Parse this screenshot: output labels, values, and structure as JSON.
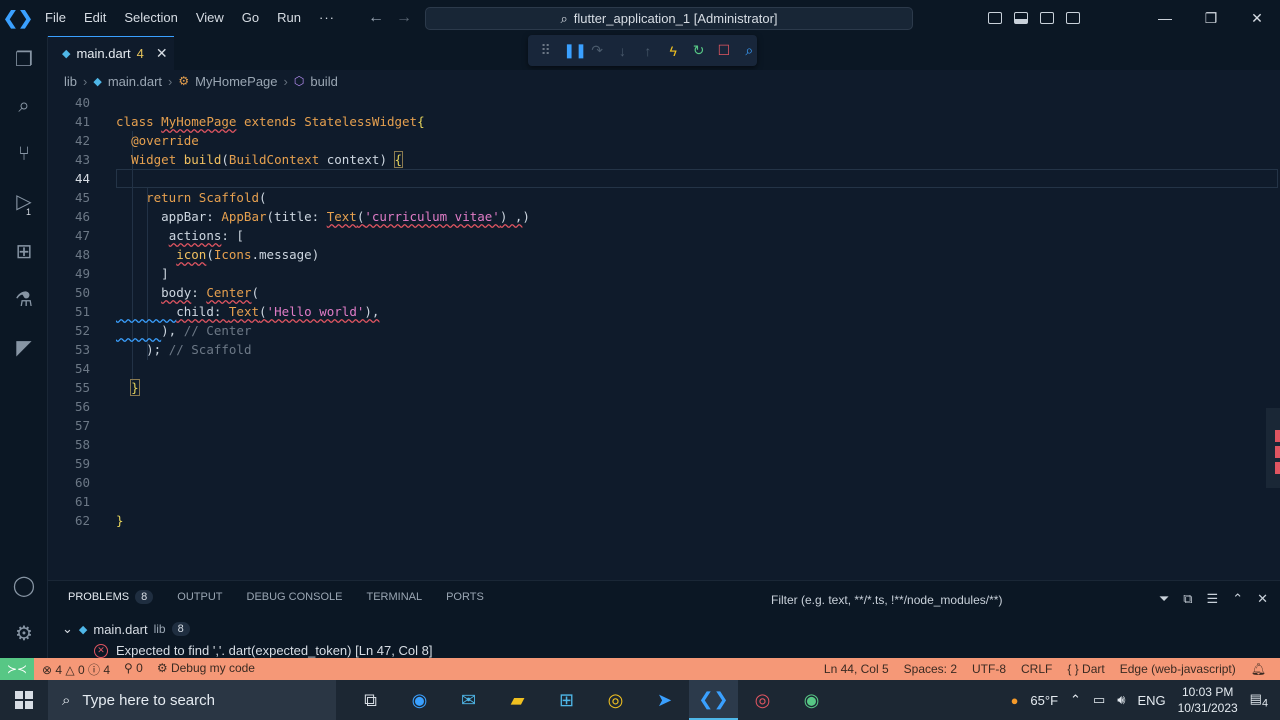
{
  "menu": [
    "File",
    "Edit",
    "Selection",
    "View",
    "Go",
    "Run",
    "···"
  ],
  "window_title": "flutter_application_1 [Administrator]",
  "tab": {
    "name": "main.dart",
    "problems": "4"
  },
  "breadcrumb": [
    "lib",
    "main.dart",
    "MyHomePage",
    "build"
  ],
  "editor": {
    "lines": [
      {
        "n": "40",
        "code": ""
      },
      {
        "n": "41",
        "code": "class MyHomePage extends StatelessWidget{"
      },
      {
        "n": "42",
        "code": "  @override"
      },
      {
        "n": "43",
        "code": "  Widget build(BuildContext context) {"
      },
      {
        "n": "44",
        "code": ""
      },
      {
        "n": "45",
        "code": "    return Scaffold("
      },
      {
        "n": "46",
        "code": "      appBar: AppBar(title: Text('curriculum vitae') ,)"
      },
      {
        "n": "47",
        "code": "       actions: ["
      },
      {
        "n": "48",
        "code": "        icon(Icons.message)"
      },
      {
        "n": "49",
        "code": "      ]"
      },
      {
        "n": "50",
        "code": "      body: Center("
      },
      {
        "n": "51",
        "code": "        child: Text('Hello world'),"
      },
      {
        "n": "52",
        "code": "      ), // Center"
      },
      {
        "n": "53",
        "code": "    ); // Scaffold"
      },
      {
        "n": "54",
        "code": ""
      },
      {
        "n": "55",
        "code": "  }"
      },
      {
        "n": "56",
        "code": ""
      },
      {
        "n": "57",
        "code": ""
      },
      {
        "n": "58",
        "code": ""
      },
      {
        "n": "59",
        "code": ""
      },
      {
        "n": "60",
        "code": ""
      },
      {
        "n": "61",
        "code": ""
      },
      {
        "n": "62",
        "code": "}"
      }
    ]
  },
  "panel": {
    "tabs": [
      "PROBLEMS",
      "OUTPUT",
      "DEBUG CONSOLE",
      "TERMINAL",
      "PORTS"
    ],
    "problems_count": "8",
    "filter_placeholder": "Filter (e.g. text, **/*.ts, !**/node_modules/**)",
    "file": "main.dart",
    "file_dir": "lib",
    "file_count": "8",
    "error": "Expected to find ','.  dart(expected_token)  [Ln 47, Col 8]"
  },
  "status": {
    "errors": "4",
    "warnings": "0",
    "infos": "4",
    "ports": "0",
    "debug": "Debug my code",
    "position": "Ln 44, Col 5",
    "spaces": "Spaces: 2",
    "encoding": "UTF-8",
    "eol": "CRLF",
    "language": "Dart",
    "device": "Edge (web-javascript)"
  },
  "taskbar": {
    "search": "Type here to search",
    "weather": "65°F",
    "lang": "ENG",
    "time": "10:03 PM",
    "date": "10/31/2023",
    "notif": "4"
  },
  "colors": {
    "accent": "#3aa0ff",
    "status_bg": "#f59877",
    "error": "#e05561"
  }
}
